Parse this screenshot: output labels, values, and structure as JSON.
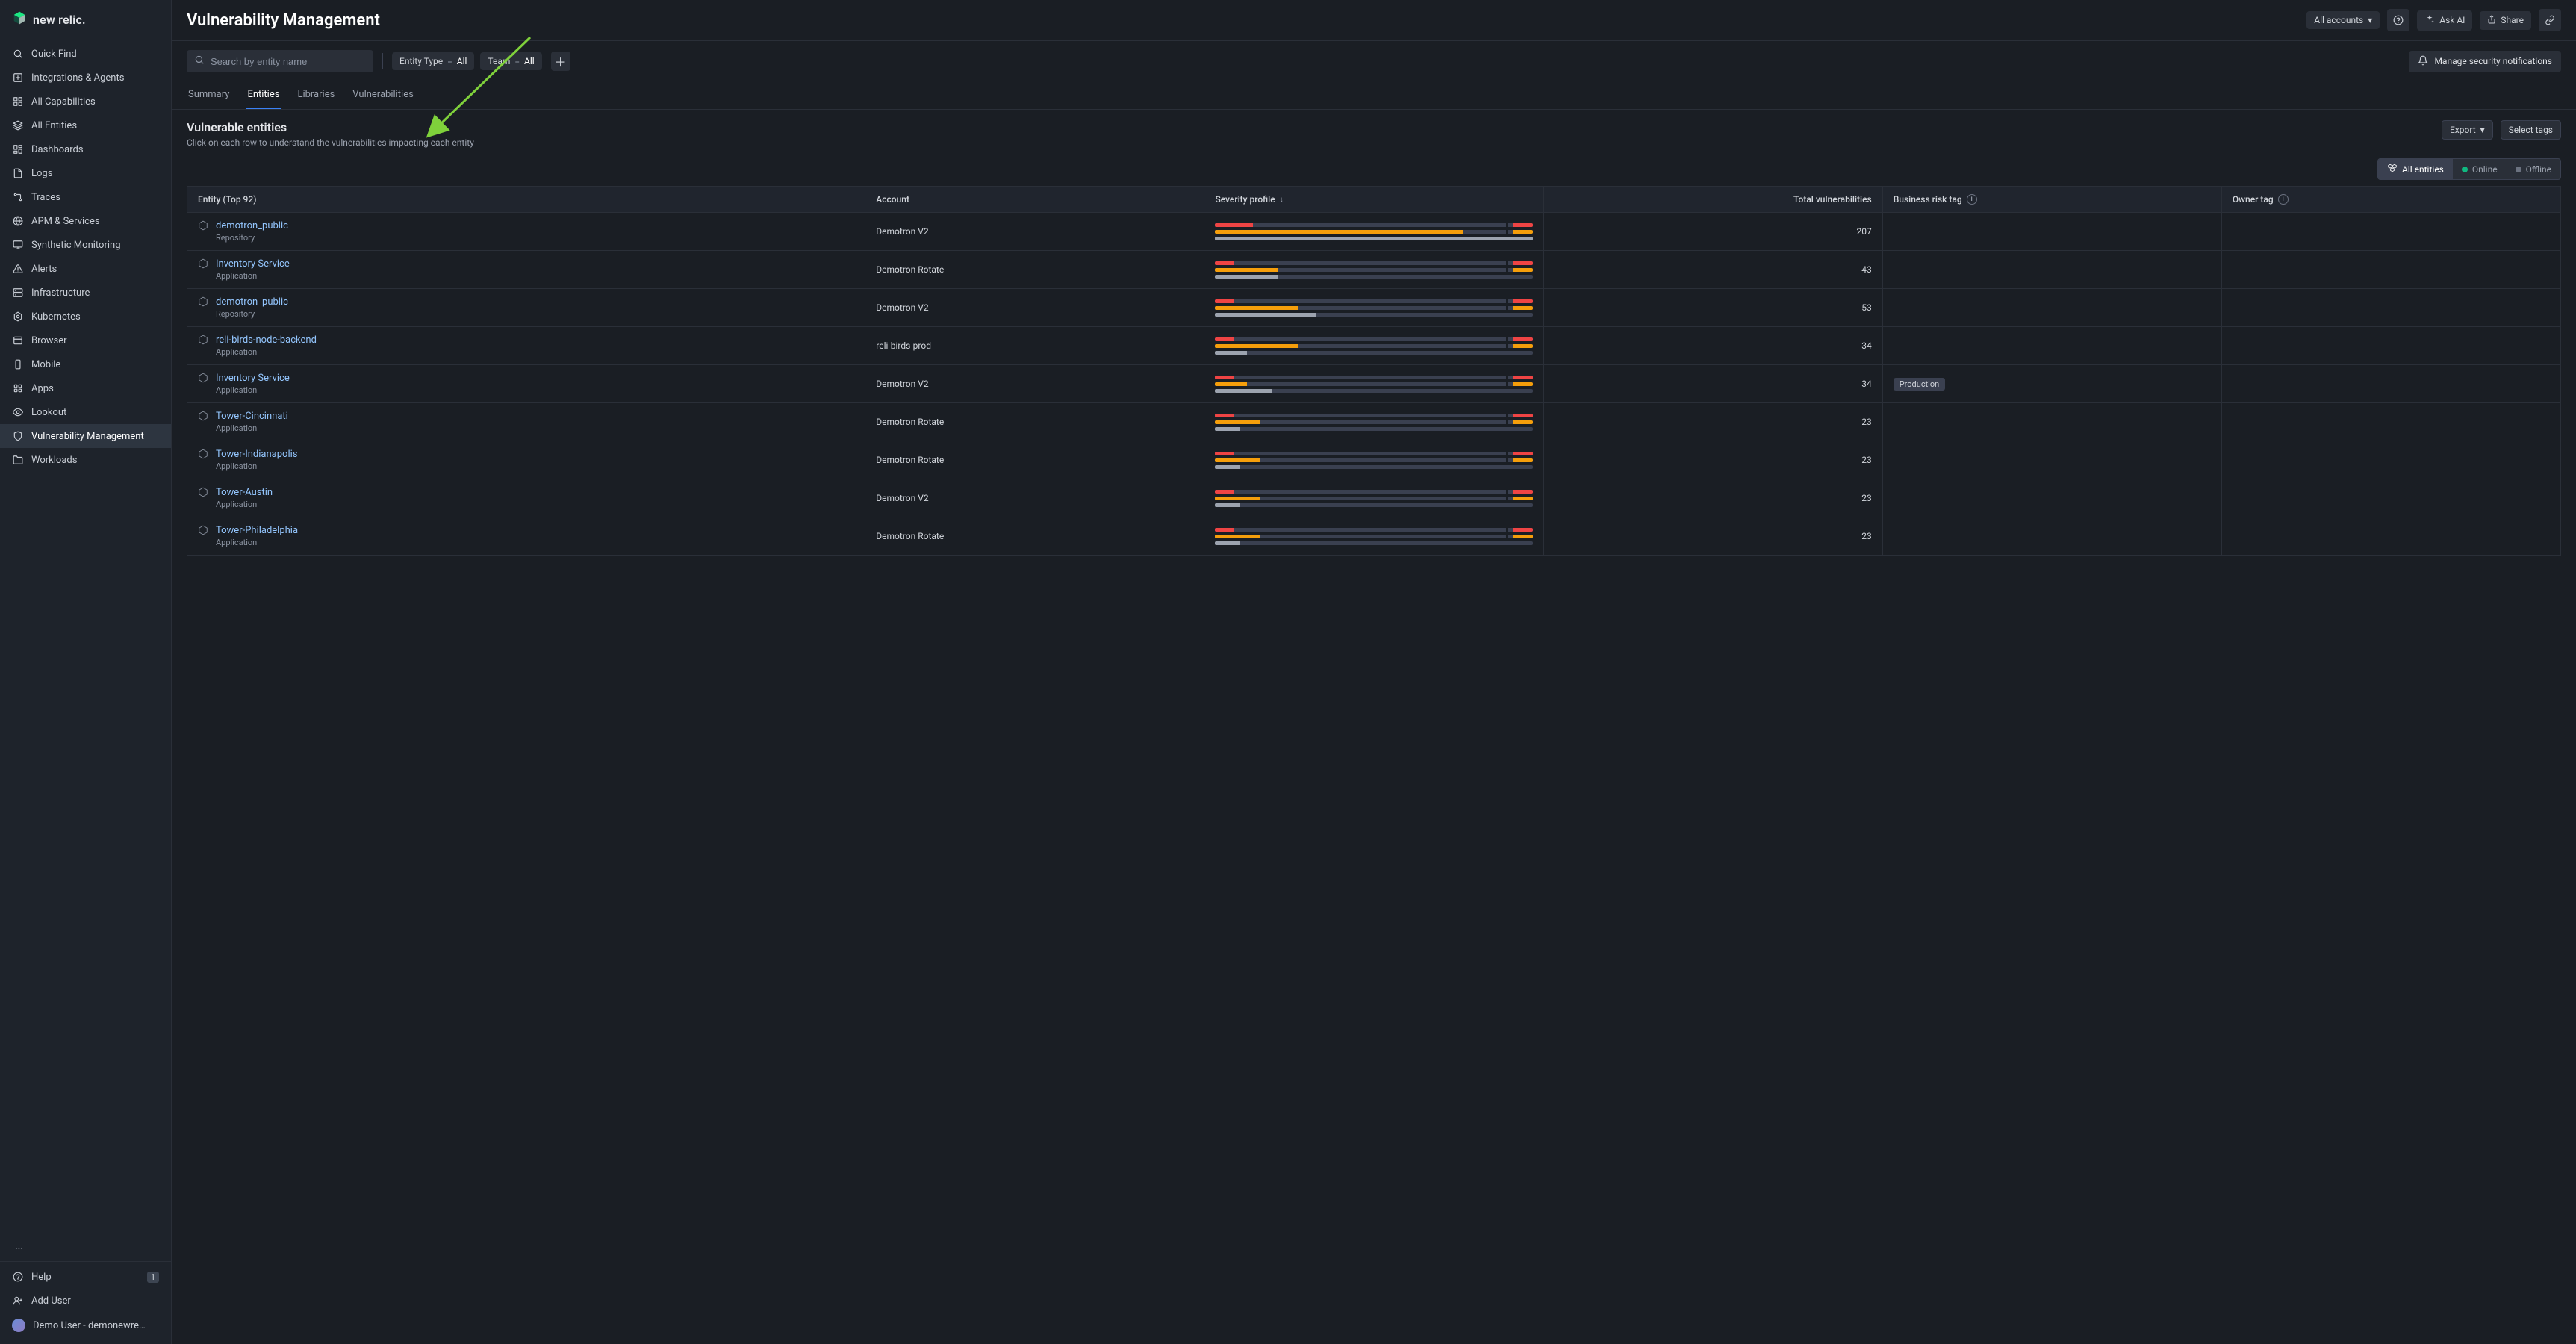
{
  "brand": "new relic.",
  "sidebar": {
    "items": [
      {
        "label": "Quick Find",
        "icon": "search"
      },
      {
        "label": "Integrations & Agents",
        "icon": "plus-box"
      },
      {
        "label": "All Capabilities",
        "icon": "grid"
      },
      {
        "label": "All Entities",
        "icon": "layers"
      },
      {
        "label": "Dashboards",
        "icon": "dashboard"
      },
      {
        "label": "Logs",
        "icon": "file"
      },
      {
        "label": "Traces",
        "icon": "trace"
      },
      {
        "label": "APM & Services",
        "icon": "globe"
      },
      {
        "label": "Synthetic Monitoring",
        "icon": "monitor"
      },
      {
        "label": "Alerts",
        "icon": "alert"
      },
      {
        "label": "Infrastructure",
        "icon": "server"
      },
      {
        "label": "Kubernetes",
        "icon": "k8s"
      },
      {
        "label": "Browser",
        "icon": "window"
      },
      {
        "label": "Mobile",
        "icon": "mobile"
      },
      {
        "label": "Apps",
        "icon": "apps"
      },
      {
        "label": "Lookout",
        "icon": "eye"
      },
      {
        "label": "Vulnerability Management",
        "icon": "shield"
      },
      {
        "label": "Workloads",
        "icon": "folder"
      }
    ],
    "bottom": {
      "help_label": "Help",
      "help_badge": "1",
      "add_user_label": "Add User",
      "user_label": "Demo User - demonewre…"
    }
  },
  "header": {
    "title": "Vulnerability Management",
    "accounts_label": "All accounts",
    "ask_ai_label": "Ask AI",
    "share_label": "Share"
  },
  "filters": {
    "search_placeholder": "Search by entity name",
    "chips": [
      {
        "key": "Entity Type",
        "op": "=",
        "val": "All"
      },
      {
        "key": "Team",
        "op": "=",
        "val": "All"
      }
    ],
    "manage_label": "Manage security notifications"
  },
  "tabs": [
    {
      "label": "Summary",
      "active": false
    },
    {
      "label": "Entities",
      "active": true
    },
    {
      "label": "Libraries",
      "active": false
    },
    {
      "label": "Vulnerabilities",
      "active": false
    }
  ],
  "section": {
    "title": "Vulnerable entities",
    "subtitle": "Click on each row to understand the vulnerabilities impacting each entity",
    "export_label": "Export",
    "select_tags_label": "Select tags"
  },
  "segmented": [
    {
      "label": "All entities",
      "active": true,
      "icon": "hex-group"
    },
    {
      "label": "Online",
      "active": false,
      "dot": "green"
    },
    {
      "label": "Offline",
      "active": false,
      "dot": "gray"
    }
  ],
  "columns": {
    "entity": "Entity (Top 92)",
    "account": "Account",
    "severity": "Severity profile",
    "total": "Total vulnerabilities",
    "biz": "Business risk tag",
    "owner": "Owner tag"
  },
  "rows": [
    {
      "name": "demotron_public",
      "sub": "Repository",
      "account": "Demotron V2",
      "total": "207",
      "biz": "",
      "sev": {
        "crit": 12,
        "high": 78,
        "med": 100,
        "pip_crit": true,
        "pip_high": true
      }
    },
    {
      "name": "Inventory Service",
      "sub": "Application",
      "account": "Demotron Rotate",
      "total": "43",
      "biz": "",
      "sev": {
        "crit": 6,
        "high": 20,
        "med": 20,
        "pip_crit": true,
        "pip_high": true
      }
    },
    {
      "name": "demotron_public",
      "sub": "Repository",
      "account": "Demotron V2",
      "total": "53",
      "biz": "",
      "sev": {
        "crit": 6,
        "high": 26,
        "med": 32,
        "pip_crit": true,
        "pip_high": true
      }
    },
    {
      "name": "reli-birds-node-backend",
      "sub": "Application",
      "account": "reli-birds-prod",
      "total": "34",
      "biz": "",
      "sev": {
        "crit": 6,
        "high": 26,
        "med": 10,
        "pip_crit": true,
        "pip_high": true
      }
    },
    {
      "name": "Inventory Service",
      "sub": "Application",
      "account": "Demotron V2",
      "total": "34",
      "biz": "Production",
      "sev": {
        "crit": 6,
        "high": 10,
        "med": 18,
        "pip_crit": true,
        "pip_high": true
      }
    },
    {
      "name": "Tower-Cincinnati",
      "sub": "Application",
      "account": "Demotron Rotate",
      "total": "23",
      "biz": "",
      "sev": {
        "crit": 6,
        "high": 14,
        "med": 8,
        "pip_crit": true,
        "pip_high": true
      }
    },
    {
      "name": "Tower-Indianapolis",
      "sub": "Application",
      "account": "Demotron Rotate",
      "total": "23",
      "biz": "",
      "sev": {
        "crit": 6,
        "high": 14,
        "med": 8,
        "pip_crit": true,
        "pip_high": true
      }
    },
    {
      "name": "Tower-Austin",
      "sub": "Application",
      "account": "Demotron V2",
      "total": "23",
      "biz": "",
      "sev": {
        "crit": 6,
        "high": 14,
        "med": 8,
        "pip_crit": true,
        "pip_high": true
      }
    },
    {
      "name": "Tower-Philadelphia",
      "sub": "Application",
      "account": "Demotron Rotate",
      "total": "23",
      "biz": "",
      "sev": {
        "crit": 6,
        "high": 14,
        "med": 8,
        "pip_crit": true,
        "pip_high": true
      }
    }
  ]
}
